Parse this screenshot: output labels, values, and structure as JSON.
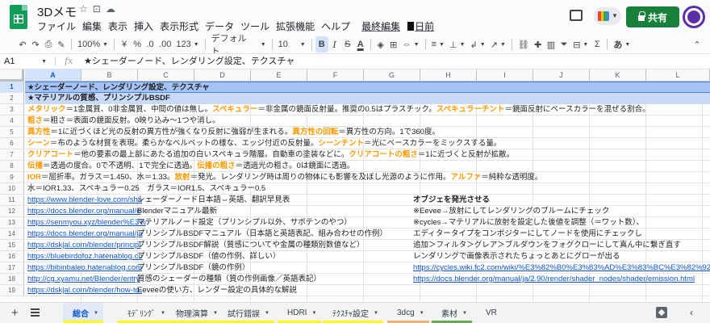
{
  "header": {
    "title": "3Dメモ",
    "menu": [
      "ファイル",
      "編集",
      "表示",
      "挿入",
      "表示形式",
      "データ",
      "ツール",
      "拡張機能",
      "ヘルプ"
    ],
    "last_edit_prefix": "最終編集",
    "last_edit_suffix": "日前",
    "share_label": "共有"
  },
  "toolbar": {
    "zoom": "100%",
    "currency": "¥",
    "percent": "%",
    "dec_less": ".0",
    "dec_more": ".00",
    "format_more": "123",
    "font": "デフォルト…",
    "font_size": "10",
    "bold": "B",
    "italic": "I",
    "strike": "S",
    "text_color": "A",
    "input_tools": "あ"
  },
  "formula_bar": {
    "cell_ref": "A1",
    "fx": "fx",
    "content": "★シェーダーノード、レンダリング設定、テクスチャ"
  },
  "columns": [
    "A",
    "B",
    "C",
    "D",
    "E",
    "F",
    "G",
    "H",
    "I",
    "J",
    "K",
    "L"
  ],
  "row_numbers": [
    "1",
    "2",
    "3",
    "4",
    "5",
    "6",
    "7",
    "8",
    "9",
    "10",
    "11",
    "12",
    "13",
    "14",
    "15",
    "16",
    "17",
    "18",
    "19"
  ],
  "rows": {
    "r1": "★シェーダーノード、レンダリング設定、テクスチャ",
    "r2": "★マテリアルの質感、プリンシプルBSDF",
    "r3": [
      {
        "t": "メタリック",
        "o": true
      },
      {
        "t": "＝1金属質、0非金属質、中間の値は無し。"
      },
      {
        "t": "スペキュラー",
        "o": true
      },
      {
        "t": "＝非金属の鏡面反射量。推奨の0.5はプラスチック。"
      },
      {
        "t": "スペキュラーチント",
        "o": true
      },
      {
        "t": "＝鏡面反射にベースカラーを混ぜる割合。"
      }
    ],
    "r4": [
      {
        "t": "粗さ",
        "o": true
      },
      {
        "t": "＝粗さ＝表面の鏡面反射。0映り込み〜1つや消し。"
      }
    ],
    "r5": [
      {
        "t": "異方性",
        "o": true
      },
      {
        "t": "＝1に近づくほど光の反射の異方性が強くなり反射に強弱が生まれる。"
      },
      {
        "t": "異方性の回転",
        "o": true
      },
      {
        "t": "＝異方性の方向。1で360度。"
      }
    ],
    "r6": [
      {
        "t": "シーン",
        "o": true
      },
      {
        "t": "＝布のような材質を表現。柔らかなベルベットの様な、エッジ付近の反射量。"
      },
      {
        "t": "シーンチント",
        "o": true
      },
      {
        "t": "＝光にベースカラーをミックスする量。"
      }
    ],
    "r7": [
      {
        "t": "クリアコート",
        "o": true
      },
      {
        "t": "＝他の要素の最上部にあたる追加の白いスペキュラ階層。自動車の塗装などに。"
      },
      {
        "t": "クリアコートの粗さ",
        "o": true
      },
      {
        "t": "＝1に近づくと反射が拡散。"
      }
    ],
    "r8": [
      {
        "t": "伝播",
        "o": true
      },
      {
        "t": "＝透過の度合。0で不透明、1で完全に透過。"
      },
      {
        "t": "伝播の粗さ",
        "o": true
      },
      {
        "t": "＝透過光の粗さ。0は鏡面に透過。"
      }
    ],
    "r9": [
      {
        "t": "IOR",
        "o": true
      },
      {
        "t": "＝屈折率。ガラス＝1.450、水＝1.33。"
      },
      {
        "t": "放射",
        "o": true
      },
      {
        "t": "＝発光。レンダリング時は周りの物体にも影響を及ぼし光源のように作用。"
      },
      {
        "t": "アルファ",
        "o": true
      },
      {
        "t": "＝純粋な透明度。"
      }
    ],
    "r10": "水＝IOR1.33、スペキュラー0.25　ガラス＝IOR1.5、スペキュラー0.5",
    "links": [
      {
        "url": "https://www.blender-love.com/sha",
        "desc": "シェーダーノード日本語⇔英語、翻訳早見表",
        "h": "オブジェを発光させる",
        "h_bold": true
      },
      {
        "url": "https://docs.blender.org/manual/e",
        "desc": "Blenderマニュアル最新",
        "h": "※Eevee→放射にしてレンダリングのブルームにチェック"
      },
      {
        "url": "https://senmyou.xyz/blender%E3%",
        "desc": "マテリアルノード設定（プリンシプル以外、サボテンのやつ）",
        "h": "※cycles→マテリアルに放射を設定した後値を調整（＝ワット数）、"
      },
      {
        "url": "https://docs.blender.org/manual/ja",
        "desc": "プリンシプルBSDFマニュアル（日本語と英語表記、組み合わせの作例）",
        "h": "エディタータイプをコンポジターにしてノードを使用にチェックし"
      },
      {
        "url": "https://dskjal.com/blender/principl",
        "desc": "プリンシプルBSDF解説（質感についてや金属の種類別数値など）",
        "h": "追加＞フィルタ＞グレア＞ブルダウンをフォグクローにして真ん中に繋ぎ直す"
      },
      {
        "url": "https://bluebirdofoz.hatenablog.co",
        "desc": "プリンシプルBSDF（値の作例、詳しい）",
        "h": "レンダリングで画像表示されたちょっとあとにグローが出る"
      },
      {
        "url": "https://bibinbaleo.hatenablog.com",
        "desc": "プリンシプルBSDF（鏡の作例）",
        "h": "https://cycles.wiki.fc2.com/wiki/%E3%82%B0%E3%83%AD%E3%83%BC%E3%82%92%E3%",
        "h_link": true
      },
      {
        "url": "http://cg.xyamu.net/Blender/entry",
        "desc": "質感のシェーダーの種類（質の作例画像／英語表記）",
        "h": "https://docs.blender.org/manual/ja/2.90/render/shader_nodes/shader/emission.html",
        "h_link": true
      },
      {
        "url": "https://dskjal.com/blender/how-to-",
        "desc": "Eeveeの使い方、レンダー設定の具体的な解説",
        "h": ""
      }
    ]
  },
  "tabs": [
    {
      "label": "総合",
      "active": true,
      "color": "#ffff00"
    },
    {
      "label": "ﾓﾃﾞﾘﾝｸﾞ",
      "color": "#ffff00"
    },
    {
      "label": "物理演算",
      "color": "#ffff00"
    },
    {
      "label": "試行錯誤",
      "color": "#ffff00"
    },
    {
      "label": "HDRI",
      "color": "#ffff00"
    },
    {
      "label": "ﾃｸｽﾁｬ設定",
      "color": "#ffff00"
    },
    {
      "label": "3dcg",
      "color": "#f6b26b"
    },
    {
      "label": "素材",
      "color": "#6aa84f"
    },
    {
      "label": "VR",
      "color": ""
    }
  ]
}
